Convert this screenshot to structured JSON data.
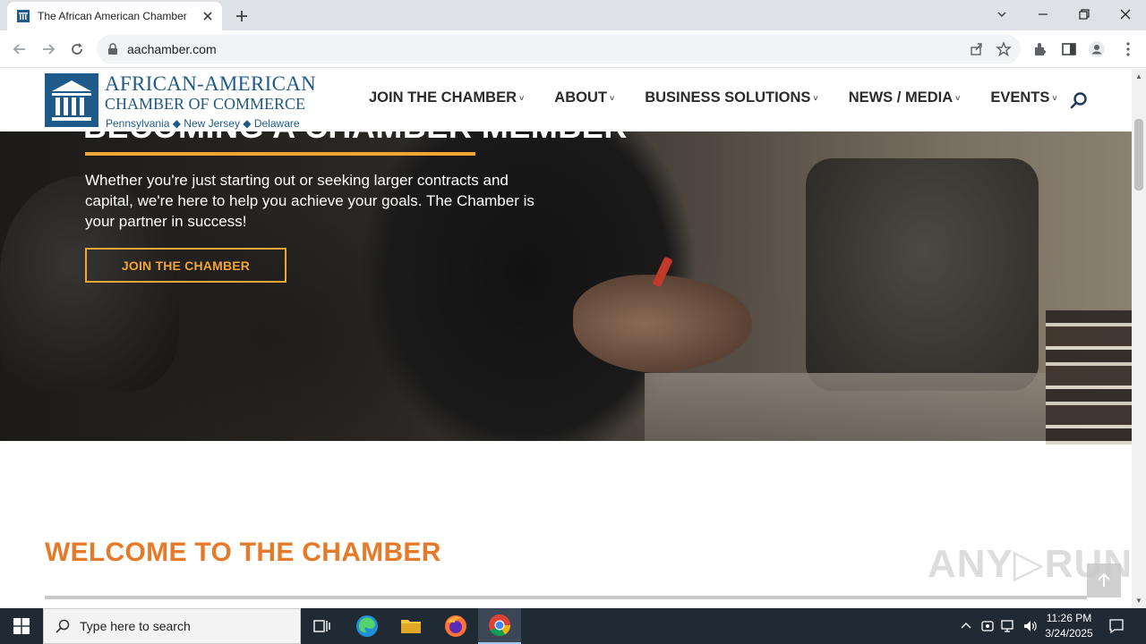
{
  "browser": {
    "tab_title": "The African American Chamber",
    "url": "aachamber.com"
  },
  "header": {
    "logo": {
      "line1": "AFRICAN-AMERICAN",
      "line2": "CHAMBER OF COMMERCE",
      "line3": "Pennsylvania  ◆  New Jersey  ◆  Delaware"
    },
    "nav": [
      {
        "label": "JOIN THE CHAMBER"
      },
      {
        "label": "ABOUT"
      },
      {
        "label": "BUSINESS SOLUTIONS"
      },
      {
        "label": "NEWS / MEDIA"
      },
      {
        "label": "EVENTS"
      }
    ],
    "chevron": "˅"
  },
  "hero": {
    "heading": "BECOMING A CHAMBER MEMBER",
    "text": "Whether you're just starting out or seeking larger contracts and capital, we're here to help you achieve your goals. The Chamber is your partner in success!",
    "button": "JOIN THE CHAMBER"
  },
  "welcome": {
    "heading": "WELCOME TO THE CHAMBER"
  },
  "watermark": "ANY▷RUN",
  "taskbar": {
    "search_placeholder": "Type here to search",
    "time": "11:26 PM",
    "date": "3/24/2025"
  },
  "colors": {
    "accent_orange": "#e57b2a",
    "hero_gold": "#f0a534",
    "logo_blue": "#1e5a8a"
  }
}
